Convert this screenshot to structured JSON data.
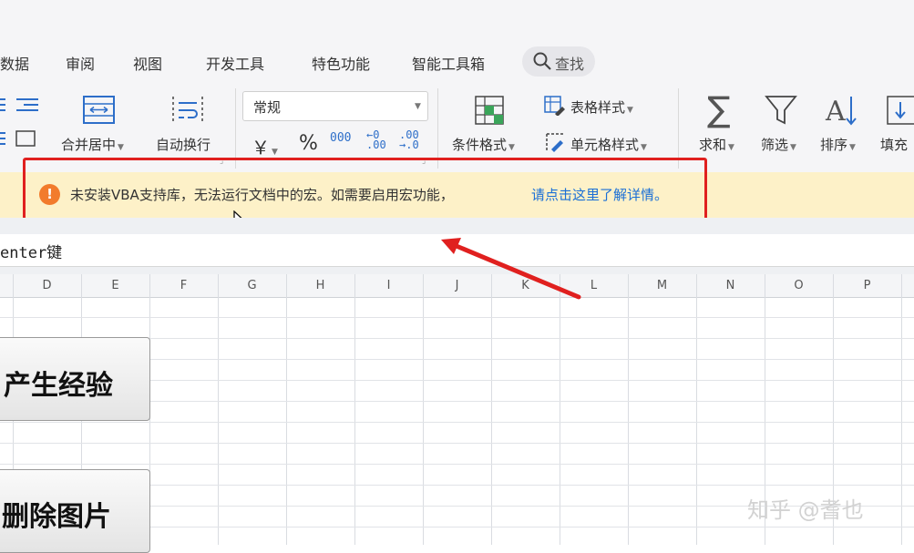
{
  "menu": {
    "items": [
      "数据",
      "审阅",
      "视图",
      "开发工具",
      "特色功能",
      "智能工具箱"
    ],
    "search_label": "查找"
  },
  "ribbon": {
    "merge_center": "合并居中",
    "auto_wrap": "自动换行",
    "number_format": "常规",
    "currency_symbol": "￥",
    "percent_symbol": "%",
    "thousands_symbol": "000",
    "decimal_increase_top": "←0",
    "decimal_increase_bottom": ".00",
    "decimal_decrease_top": ".00",
    "decimal_decrease_bottom": "→.0",
    "conditional_format": "条件格式",
    "table_style": "表格样式",
    "cell_style": "单元格样式",
    "sum": "求和",
    "filter": "筛选",
    "sort": "排序",
    "fill": "填充"
  },
  "infobar": {
    "message": "未安装VBA支持库，无法运行文档中的宏。如需要启用宏功能，",
    "link": "请点击这里了解详情。"
  },
  "formula_bar": {
    "content": "enter键"
  },
  "columns": [
    "D",
    "E",
    "F",
    "G",
    "H",
    "I",
    "J",
    "K",
    "L",
    "M",
    "N",
    "O",
    "P"
  ],
  "sheet_buttons": {
    "button1": "产生经验",
    "button2": "删除图片"
  },
  "watermark": "知乎 @耆也",
  "colors": {
    "accent_blue": "#1a6fd6",
    "infobar_bg": "#fdf1c8",
    "warning_orange": "#f27b2c",
    "annotation_red": "#e0201f"
  }
}
